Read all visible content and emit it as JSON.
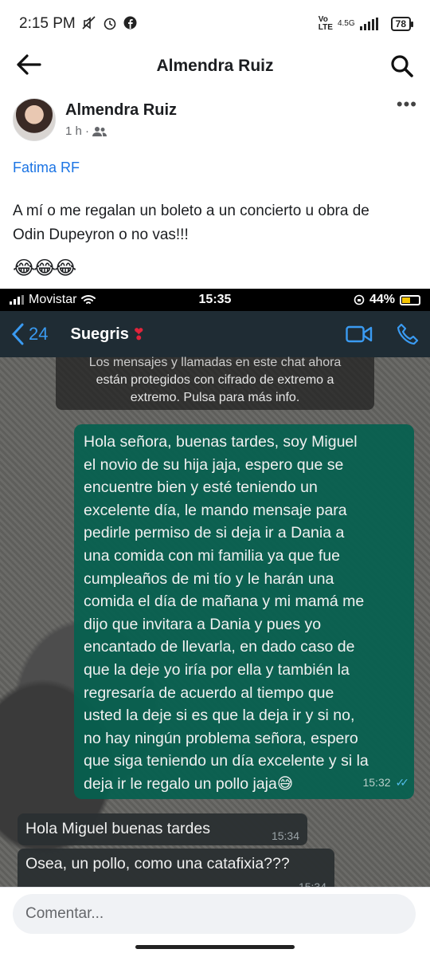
{
  "status_bar": {
    "time": "2:15 PM",
    "network_top": "Vo",
    "network_bottom": "LTE",
    "net_type": "4.5G",
    "battery": "78"
  },
  "app_bar": {
    "title": "Almendra Ruiz"
  },
  "post": {
    "author": "Almendra Ruiz",
    "time": "1 h ·",
    "more_label": "•••",
    "tag": "Fatima RF",
    "text_line1": "A mí o me regalan un boleto a un concierto u obra de",
    "text_line2": "Odin Dupeyron  o no vas!!!",
    "emojis": "😂😂😂"
  },
  "screenshot": {
    "carrier": "Movistar",
    "time": "15:35",
    "battery": "44%",
    "back_count": "24",
    "contact_name": "Suegris",
    "notice": {
      "line1": "Los mensajes y llamadas en este chat ahora",
      "line2": "están protegidos con cifrado de extremo a",
      "line3": "extremo. Pulsa para más info."
    },
    "outgoing": {
      "lines": [
        "Hola señora, buenas tardes, soy Miguel",
        "el novio de su hija jaja, espero que se",
        "encuentre bien y esté teniendo un",
        "excelente día, le mando mensaje para",
        "pedirle permiso de si deja ir a Dania a",
        "una comida con mi familia ya que fue",
        "cumpleaños de mi tío y le harán una",
        "comida el día de mañana y mi mamá me",
        "dijo que invitara a Dania y pues yo",
        "encantado de llevarla, en dado caso de",
        "que la deje yo iría por ella y también la",
        "regresaría de acuerdo al tiempo que",
        "usted la deje si es que la deja ir y si no,",
        "no hay ningún problema señora, espero",
        "que siga teniendo un día excelente y si la",
        "deja ir le regalo un pollo jaja😅"
      ],
      "time": "15:32"
    },
    "incoming": [
      {
        "text": "Hola Miguel buenas tardes",
        "time": "15:34"
      },
      {
        "text": "Osea, un pollo, como una catafixia???",
        "time": "15:34"
      }
    ]
  },
  "comment": {
    "placeholder": "Comentar..."
  },
  "icons": {
    "back": "arrow-left-icon",
    "search": "search-icon",
    "group": "friends-icon",
    "video": "video-call-icon",
    "call": "phone-icon"
  },
  "colors": {
    "tag_blue": "#1b74e4",
    "wa_outgoing": "#05614f",
    "wa_header": "#1f2c34",
    "ios_link": "#3a9bf2"
  }
}
